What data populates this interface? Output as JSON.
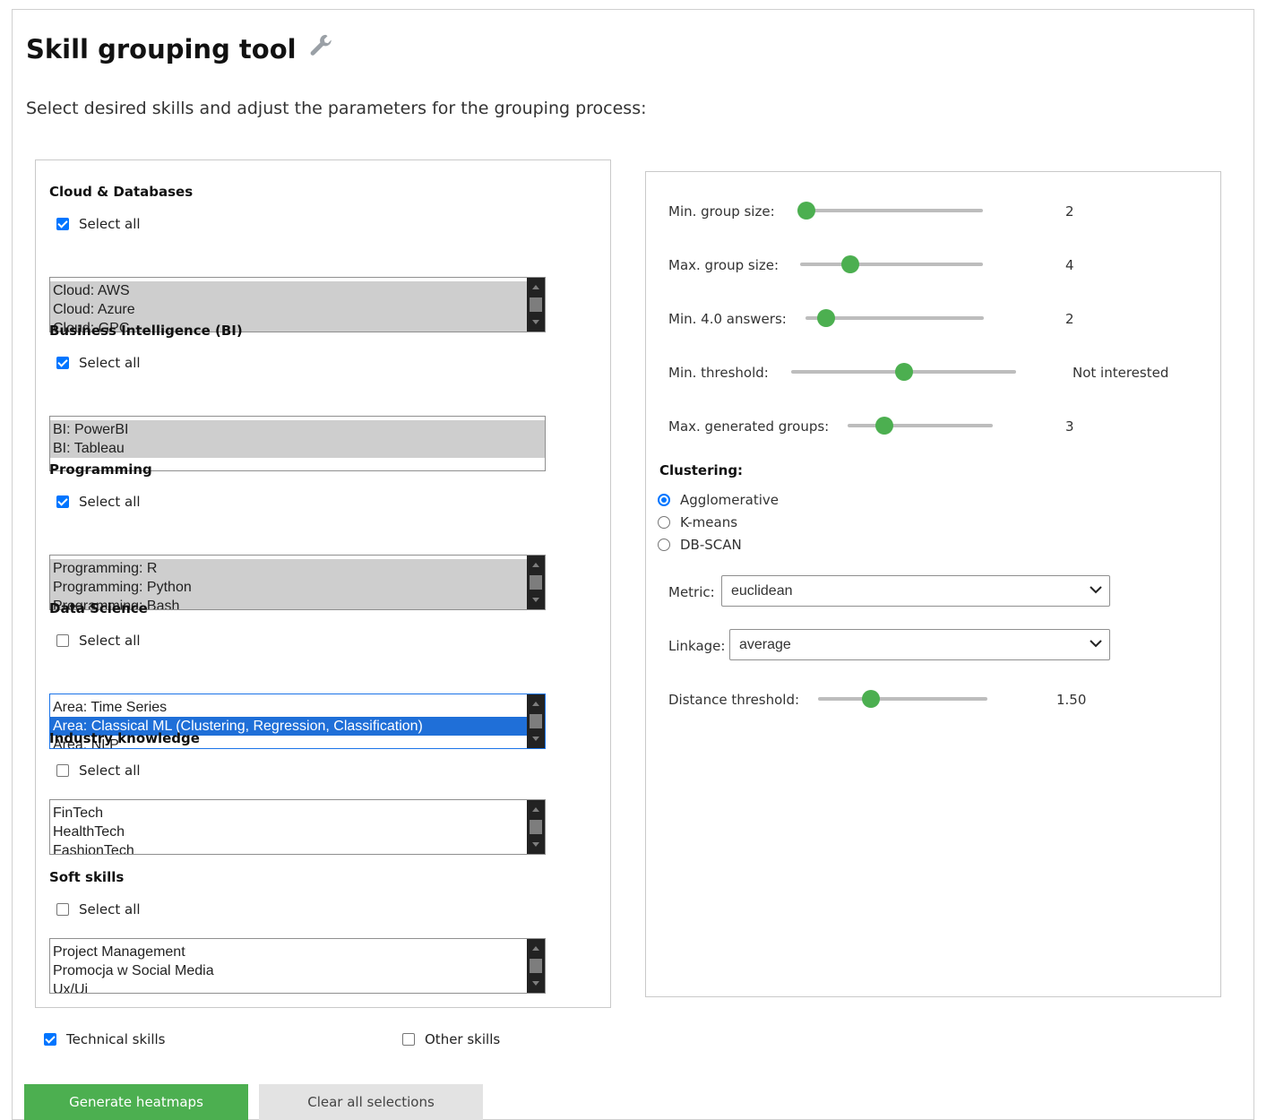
{
  "header": {
    "title": "Skill grouping tool",
    "subtitle": "Select desired skills and adjust the parameters for the grouping process:"
  },
  "skill_groups": [
    {
      "title": "Cloud & Databases",
      "select_all_label": "Select all",
      "select_all_checked": true,
      "options": [
        "Cloud: AWS",
        "Cloud: Azure",
        "Cloud: GPC"
      ],
      "selected": [
        0,
        1,
        2
      ],
      "scrollbar": true
    },
    {
      "title": "Business Intelligence (BI)",
      "select_all_label": "Select all",
      "select_all_checked": true,
      "options": [
        "BI: PowerBI",
        "BI: Tableau"
      ],
      "selected": [
        0,
        1
      ],
      "scrollbar": false
    },
    {
      "title": "Programming",
      "select_all_label": "Select all",
      "select_all_checked": true,
      "options": [
        "Programming: R",
        "Programming: Python",
        "Programming: Bash"
      ],
      "selected": [
        0,
        1,
        2
      ],
      "scrollbar": true
    },
    {
      "title": "Data Science",
      "select_all_label": "Select all",
      "select_all_checked": false,
      "options": [
        "Area: Time Series",
        "Area: Classical ML (Clustering, Regression, Classification)",
        "Area: NLP"
      ],
      "selected": [],
      "active": 1,
      "scrollbar": true
    },
    {
      "title": "Industry knowledge",
      "select_all_label": "Select all",
      "select_all_checked": false,
      "options": [
        "FinTech",
        "HealthTech",
        "FashionTech"
      ],
      "selected": [],
      "scrollbar": true
    },
    {
      "title": "Soft skills",
      "select_all_label": "Select all",
      "select_all_checked": false,
      "options": [
        "Project Management",
        "Promocja w Social Media",
        "Ux/Ui"
      ],
      "selected": [],
      "scrollbar": true
    }
  ],
  "params": {
    "min_group_size": {
      "label": "Min. group size:",
      "value": "2",
      "fraction": 0.0
    },
    "max_group_size": {
      "label": "Max. group size:",
      "value": "4",
      "fraction": 0.25
    },
    "min_answers": {
      "label": "Min. 4.0 answers:",
      "value": "2",
      "fraction": 0.07
    },
    "min_threshold": {
      "label": "Min. threshold:",
      "value": "Not interested",
      "fraction": 0.5
    },
    "max_generated_groups": {
      "label": "Max. generated groups:",
      "value": "3",
      "fraction": 0.22
    },
    "clustering": {
      "label": "Clustering:",
      "options": [
        "Agglomerative",
        "K-means",
        "DB-SCAN"
      ],
      "selected": 0
    },
    "metric": {
      "label": "Metric:",
      "value": "euclidean"
    },
    "linkage": {
      "label": "Linkage:",
      "value": "average"
    },
    "distance_threshold": {
      "label": "Distance threshold:",
      "value": "1.50",
      "fraction": 0.29
    }
  },
  "footer": {
    "technical_skills": {
      "label": "Technical skills",
      "checked": true
    },
    "other_skills": {
      "label": "Other skills",
      "checked": false
    },
    "generate_button": "Generate heatmaps",
    "clear_button": "Clear all selections"
  }
}
